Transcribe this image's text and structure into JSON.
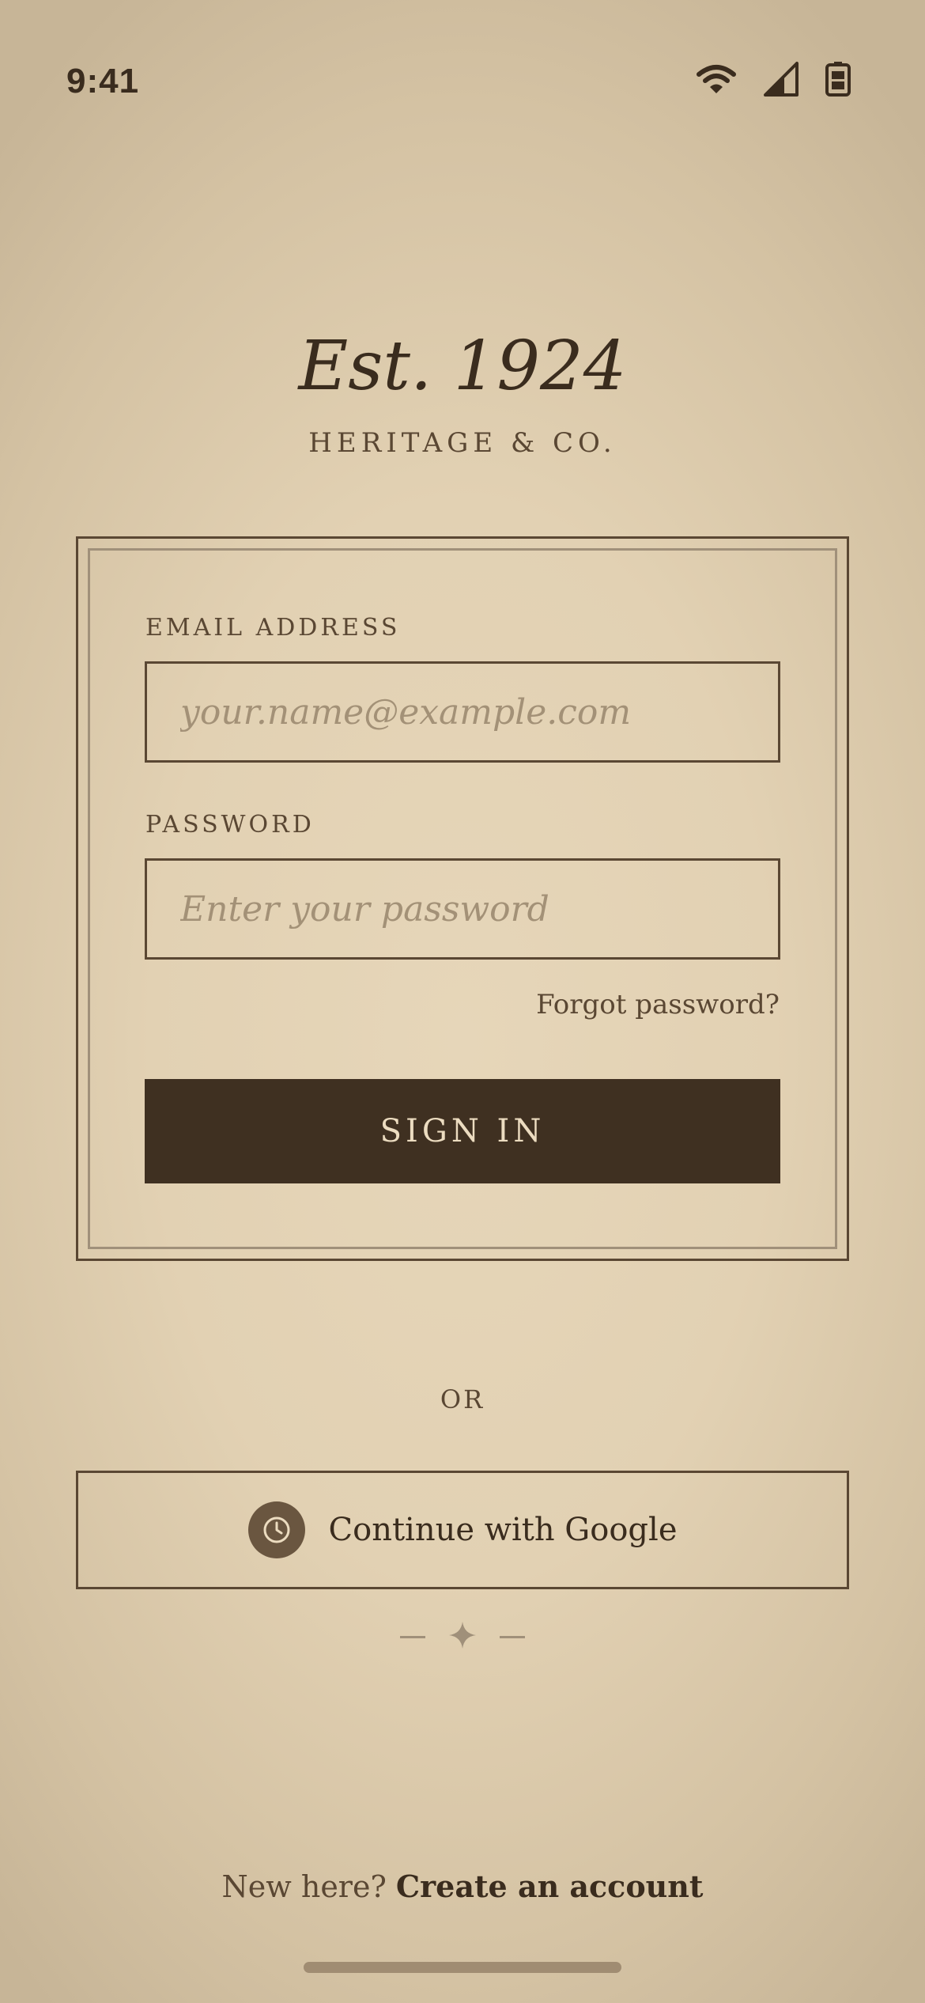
{
  "status_bar": {
    "time": "9:41",
    "icons": [
      "wifi-icon",
      "cellular-signal-icon",
      "battery-icon"
    ]
  },
  "brand": {
    "title": "Est. 1924",
    "subtitle": "HERITAGE & CO."
  },
  "form": {
    "email": {
      "label": "EMAIL ADDRESS",
      "value": "",
      "placeholder": "your.name@example.com"
    },
    "password": {
      "label": "PASSWORD",
      "value": "",
      "placeholder": "Enter your password"
    },
    "forgot_link": "Forgot password?",
    "submit_label": "SIGN IN"
  },
  "divider": {
    "label": "OR"
  },
  "social": {
    "google_label": "Continue with Google",
    "icon": "clock-icon"
  },
  "ornament": {
    "icon": "four-point-star-icon"
  },
  "footer": {
    "prompt": "New here?",
    "link": "Create an account"
  },
  "colors": {
    "background": "#e2d1b3",
    "ink": "#3a2c1e",
    "muted_ink": "#5a4733",
    "button_bg": "#3f3021",
    "button_text": "#ecdcc0",
    "placeholder": "#a39177"
  }
}
